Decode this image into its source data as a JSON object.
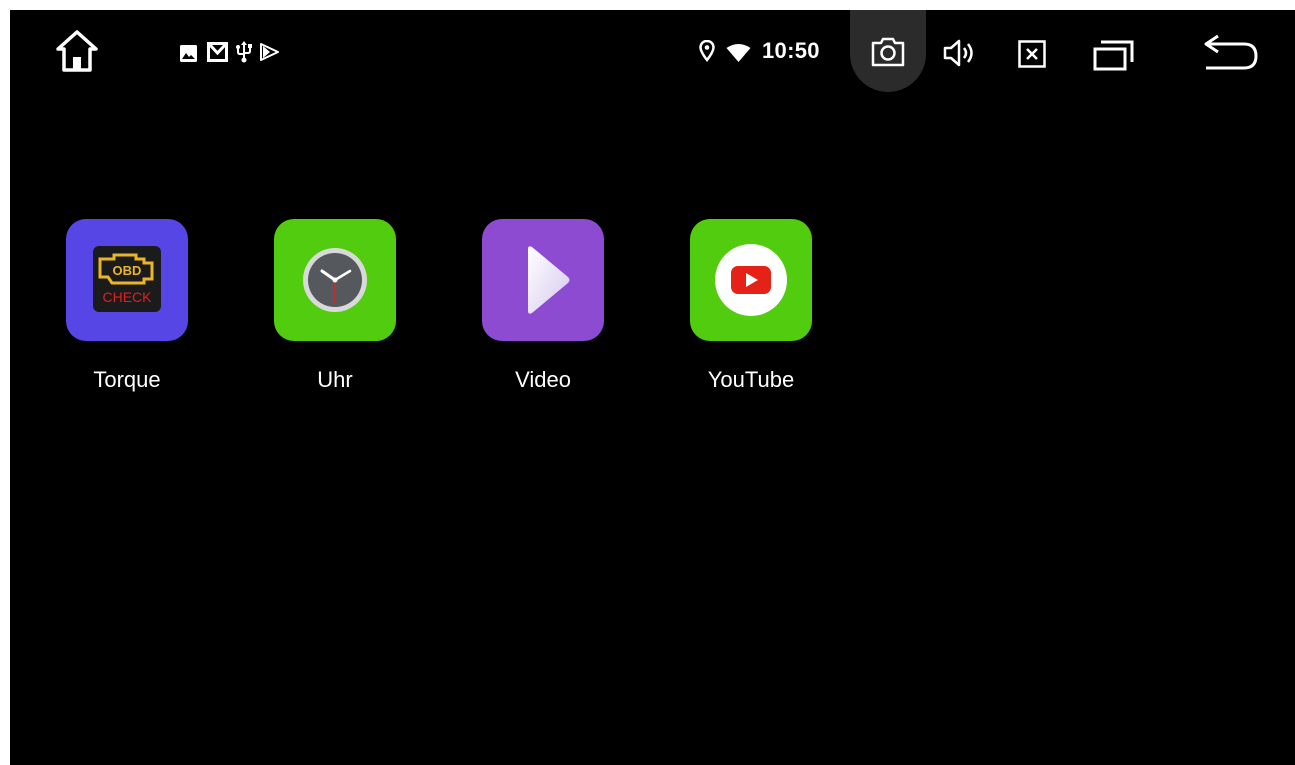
{
  "status_bar": {
    "time": "10:50",
    "notifications": [
      "image-icon",
      "gmail-icon",
      "usb-icon",
      "play-store-icon"
    ],
    "system_icons": [
      "location-icon",
      "wifi-icon"
    ],
    "buttons": [
      "home-icon",
      "screenshot-icon",
      "volume-icon",
      "close-app-icon",
      "recent-apps-icon",
      "back-icon"
    ]
  },
  "apps": [
    {
      "label": "Torque",
      "icon": "torque-obd-check-icon",
      "tile_color": "#5646e6",
      "icon_text_top": "OBD",
      "icon_text_bottom": "CHECK"
    },
    {
      "label": "Uhr",
      "icon": "clock-icon",
      "tile_color": "#52cc0e"
    },
    {
      "label": "Video",
      "icon": "video-play-icon",
      "tile_color": "#8c4bd1"
    },
    {
      "label": "YouTube",
      "icon": "youtube-icon",
      "tile_color": "#52cc0e"
    }
  ],
  "colors": {
    "background": "#000000",
    "status_icon": "#ffffff",
    "screenshot_highlight": "#2b2b2b",
    "youtube_red": "#e62117"
  }
}
